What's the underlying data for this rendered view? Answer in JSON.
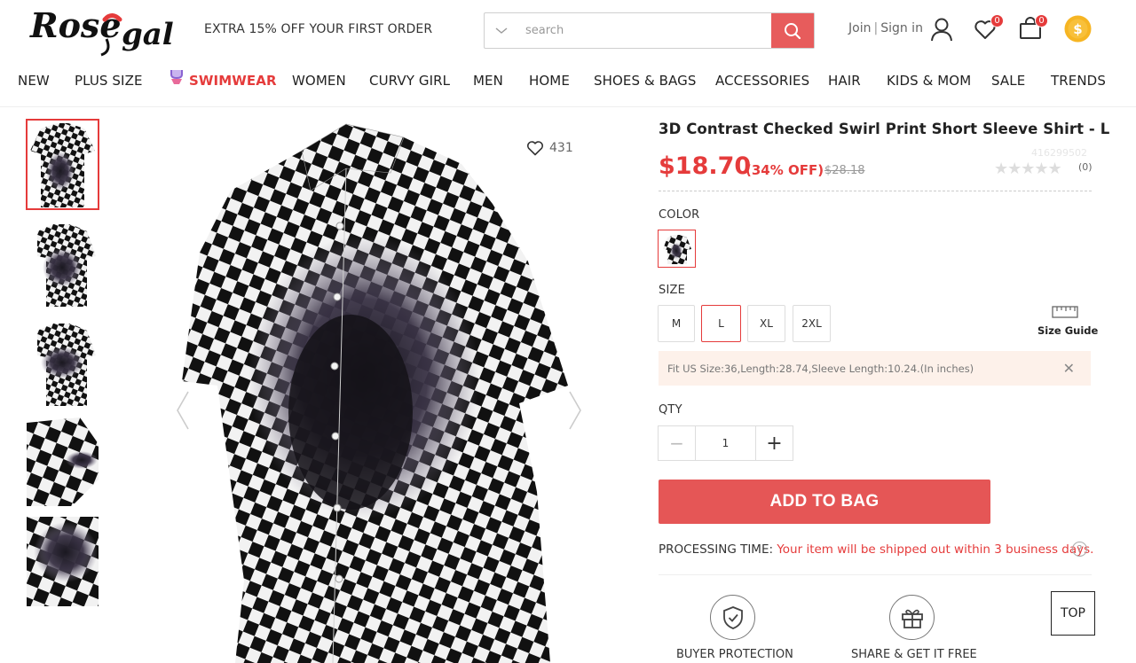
{
  "header": {
    "logo_text": "Rosegal",
    "promo": "EXTRA 15% OFF YOUR FIRST ORDER",
    "search_placeholder": "search",
    "join": "Join",
    "sign_in": "Sign in",
    "wishlist_count": "0",
    "cart_count": "0",
    "icons": [
      "chevron-down-icon",
      "search-icon",
      "user-icon",
      "heart-icon",
      "bag-icon",
      "coin-icon"
    ]
  },
  "nav": [
    "NEW",
    "PLUS SIZE",
    "SWIMWEAR",
    "WOMEN",
    "CURVY GIRL",
    "MEN",
    "HOME",
    "SHOES & BAGS",
    "ACCESSORIES",
    "HAIR",
    "KIDS & MOM",
    "SALE",
    "TRENDS"
  ],
  "gallery": {
    "thumbnail_count": 5,
    "active_thumbnail": 1,
    "likes": "431"
  },
  "product": {
    "title": "3D Contrast Checked Swirl Print Short Sleeve Shirt - L",
    "price": "$18.70",
    "discount": "(34% OFF)",
    "original_price": "$28.18",
    "sku": "416299502",
    "rating_stars": 0,
    "review_count": "(0)",
    "color_label": "COLOR",
    "size_label": "SIZE",
    "sizes": [
      "M",
      "L",
      "XL",
      "2XL"
    ],
    "selected_size": "L",
    "size_guide": "Size Guide",
    "fit_info": "Fit US Size:36,Length:28.74,Sleeve Length:10.24.(In inches)",
    "qty_label": "QTY",
    "qty_minus": "−",
    "qty_value": "1",
    "qty_plus": "+",
    "add_to_bag": "ADD TO BAG",
    "processing_label": "PROCESSING TIME:",
    "processing_text": "Your item will be shipped out within 3 business days.",
    "help": "?"
  },
  "services": {
    "buyer_protection": "BUYER PROTECTION",
    "share": "SHARE & GET IT FREE"
  },
  "top_button": "TOP",
  "colors": {
    "accent": "#e53b3b",
    "button": "#e55656",
    "fit_bg": "#fdf1ea"
  }
}
